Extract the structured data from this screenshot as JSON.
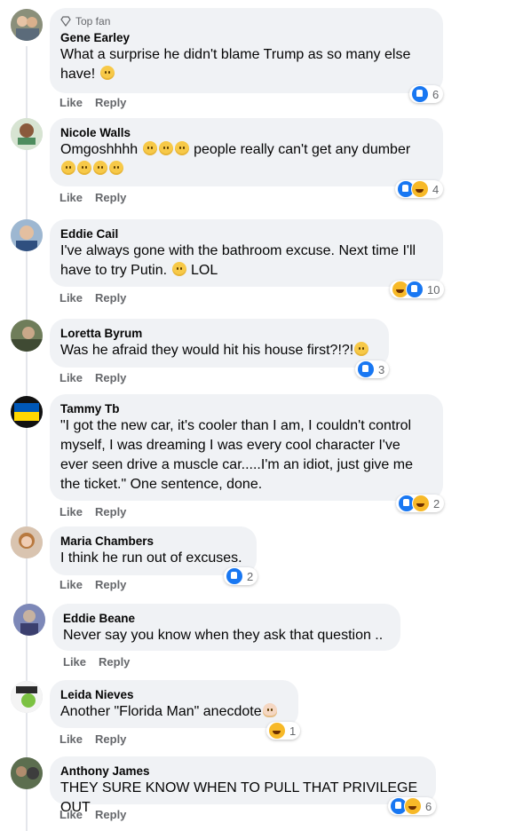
{
  "comments": [
    {
      "badge": "Top fan",
      "author": "Gene Earley",
      "text_line1": "What a surprise he didn't blame Trump as so many else",
      "text_line2": "have!",
      "like": "Like",
      "reply": "Reply",
      "reaction_count": "6",
      "reactions": [
        "like"
      ]
    },
    {
      "author": "Nicole Walls",
      "text_line1": "Omgoshhhh",
      "text_line1b": "people really can't get any dumber",
      "like": "Like",
      "reply": "Reply",
      "reaction_count": "4",
      "reactions": [
        "like",
        "haha"
      ]
    },
    {
      "author": "Eddie Cail",
      "text_line1": "I've always gone with the bathroom excuse. Next time I'll",
      "text_line2": "have to try Putin.",
      "text_line2b": "LOL",
      "like": "Like",
      "reply": "Reply",
      "reaction_count": "10",
      "reactions": [
        "haha",
        "like"
      ]
    },
    {
      "author": "Loretta Byrum",
      "text_line1": "Was he afraid they would hit his house first?!?!",
      "like": "Like",
      "reply": "Reply",
      "reaction_count": "3",
      "reactions": [
        "like"
      ]
    },
    {
      "author": "Tammy Tb",
      "text_line1": "\"I got the new car, it's cooler than I am, I couldn't control",
      "text_line2": "myself, I was dreaming I was every cool character I've",
      "text_line3": "ever seen drive a muscle car.....I'm an idiot, just give me",
      "text_line4": "the ticket.\" One sentence, done.",
      "like": "Like",
      "reply": "Reply",
      "reaction_count": "2",
      "reactions": [
        "like",
        "haha"
      ]
    },
    {
      "author": "Maria Chambers",
      "text_line1": "I think he run out of excuses.",
      "like": "Like",
      "reply": "Reply",
      "reaction_count": "2",
      "reactions": [
        "like"
      ]
    },
    {
      "author": "Eddie Beane",
      "text_line1": "Never say you know when they ask that question ..",
      "like": "Like",
      "reply": "Reply"
    },
    {
      "author": "Leida Nieves",
      "text_line1": "Another \"Florida Man\" anecdote",
      "like": "Like",
      "reply": "Reply",
      "reaction_count": "1",
      "reactions": [
        "haha"
      ]
    },
    {
      "author": "Anthony James",
      "text_line1": "THEY SURE KNOW WHEN TO PULL THAT PRIVILEGE OUT",
      "like": "Like",
      "reply": "Reply",
      "reaction_count": "6",
      "reactions": [
        "like",
        "haha"
      ]
    }
  ]
}
